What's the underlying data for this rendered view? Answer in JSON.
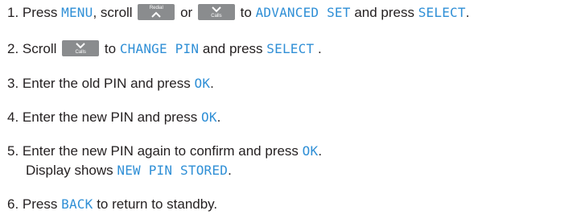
{
  "steps": [
    {
      "num": "1.",
      "parts": {
        "a": "Press",
        "menu": "MENU",
        "b": ", scroll",
        "c": "or",
        "d": "to",
        "advanced": "ADVANCED SET",
        "e": "and press",
        "select": "SELECT",
        "f": "."
      },
      "keys": {
        "redial_label": "Redial",
        "calls_label": "Calls"
      }
    },
    {
      "num": "2.",
      "parts": {
        "a": "Scroll",
        "b": "to",
        "change": "CHANGE PIN",
        "c": "and press",
        "select": "SELECT",
        "d": " ."
      },
      "keys": {
        "calls_label": "Calls"
      }
    },
    {
      "num": "3.",
      "parts": {
        "a": "Enter the old PIN and press",
        "ok": "OK",
        "b": "."
      }
    },
    {
      "num": "4.",
      "parts": {
        "a": "Enter the new PIN and press",
        "ok": "OK",
        "b": "."
      }
    },
    {
      "num": "5.",
      "parts": {
        "a": "Enter the new PIN again to confirm and press",
        "ok": "OK",
        "b": ".",
        "c": "Display shows",
        "stored": "NEW PIN STORED",
        "d": "."
      }
    },
    {
      "num": "6.",
      "parts": {
        "a": "Press",
        "back": "BACK",
        "b": "to return to standby."
      }
    }
  ],
  "colors": {
    "lcd_text": "#2f8fd6",
    "body_text": "#231f20",
    "key_bg": "#8a8c8e"
  },
  "icons": [
    "up-arrow-icon",
    "down-arrow-icon"
  ]
}
